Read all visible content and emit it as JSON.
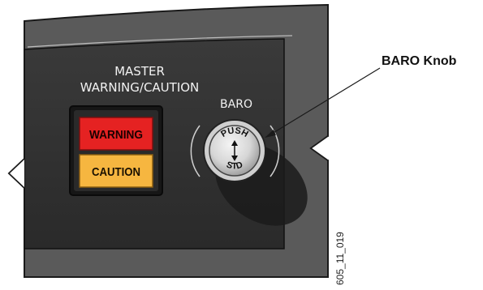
{
  "panel": {
    "title_line1": "MASTER",
    "title_line2": "WARNING/CAUTION",
    "warning_label": "WARNING",
    "caution_label": "CAUTION",
    "baro_label": "BARO",
    "knob_top_text": "PUSH",
    "knob_bottom_text": "STD"
  },
  "callout": {
    "label": "BARO Knob"
  },
  "figure_ref": "605_11_019",
  "colors": {
    "panel": "#2d2d2d",
    "frame": "#202020",
    "warning": "#e52222",
    "caution": "#f6b640",
    "knob": "#d9d9d9"
  }
}
